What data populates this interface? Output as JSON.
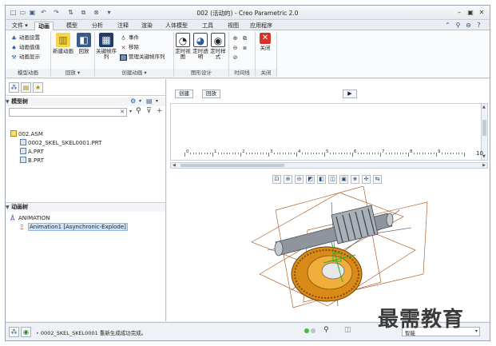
{
  "window": {
    "title": "002 (活动的) - Creo Parametric 2.0",
    "minimize_icon": "minimize-icon",
    "maximize_icon": "maximize-icon",
    "close_icon": "close-icon"
  },
  "quick_access": [
    "new-icon",
    "open-icon",
    "save-icon",
    "undo-icon",
    "redo-icon",
    "regenerate-icon",
    "windows-icon",
    "close-window-icon"
  ],
  "tabs": [
    {
      "label": "文件",
      "has_dropdown": true
    },
    {
      "label": "动画",
      "active": true
    },
    {
      "label": "模型"
    },
    {
      "label": "分析"
    },
    {
      "label": "注释"
    },
    {
      "label": "渲染"
    },
    {
      "label": "人体模型"
    },
    {
      "label": "工具"
    },
    {
      "label": "视图"
    },
    {
      "label": "应用程序"
    }
  ],
  "ribbon": {
    "groups": [
      {
        "label": "模型动画",
        "items": [
          {
            "label": "动画设置",
            "icon": "animation-settings-icon"
          },
          {
            "label": "动画值值",
            "icon": "animation-value-icon"
          },
          {
            "label": "动画显示",
            "icon": "animation-display-icon"
          }
        ]
      },
      {
        "label": "回放",
        "items": [
          {
            "label": "新建动画",
            "icon": "new-animation-icon"
          },
          {
            "label": "回放",
            "icon": "playback-icon"
          }
        ]
      },
      {
        "label": "创建动画",
        "items": [
          {
            "label": "关键帧序列",
            "icon": "keyframe-sequence-icon"
          },
          {
            "label": "事件",
            "icon": "event-icon"
          },
          {
            "label": "移除",
            "icon": "remove-icon"
          },
          {
            "label": "管理关键帧序列",
            "icon": "manage-keyframe-icon"
          }
        ]
      },
      {
        "label": "图形设计",
        "items": [
          {
            "label": "定时视图",
            "icon": "timed-view-icon"
          },
          {
            "label": "定时透明",
            "icon": "timed-transparency-icon"
          },
          {
            "label": "定时样式",
            "icon": "timed-style-icon"
          }
        ]
      },
      {
        "label": "时间线",
        "items": [
          {
            "label": "",
            "icon": "zoom-in-time-icon"
          },
          {
            "label": "",
            "icon": "zoom-out-time-icon"
          },
          {
            "label": "",
            "icon": "refit-time-icon"
          }
        ]
      },
      {
        "label": "关闭",
        "items": [
          {
            "label": "关闭",
            "icon": "close-red-icon"
          }
        ]
      }
    ],
    "right_icons": [
      "minimize-ribbon-icon",
      "search-icon",
      "help-dropdown-icon",
      "help-icon"
    ]
  },
  "left_panel": {
    "tool_buttons": [
      "model-tree-icon",
      "folder-browser-icon",
      "favorites-icon"
    ],
    "model_tree_header": "模型树",
    "search_placeholder": "",
    "model_tree_items": [
      {
        "label": "002.ASM",
        "level": 0
      },
      {
        "label": "0002_SKEL_SKEL0001.PRT",
        "level": 1
      },
      {
        "label": "A.PRT",
        "level": 1
      },
      {
        "label": "B.PRT",
        "level": 1
      }
    ],
    "animation_tree_header": "动画树",
    "animation_tree_items": [
      {
        "label": "ANIMATION",
        "level": 0
      },
      {
        "label": "Animation1 [Asynchronic-Explode]",
        "level": 1,
        "selected": true
      }
    ]
  },
  "timeline": {
    "create_label": "创建",
    "playback_label": "回放",
    "play_icon": "play-icon",
    "ruler_ticks": [
      "0",
      "1",
      "2",
      "3",
      "4",
      "5",
      "6",
      "7",
      "8",
      "9",
      "10"
    ],
    "ruler_end": "10"
  },
  "view_toolbar": [
    "refit-icon",
    "zoom-in-icon",
    "zoom-out-icon",
    "repaint-icon",
    "view-orient-icon",
    "saved-views-icon",
    "display-style-icon",
    "datum-display-icon",
    "spin-center-icon",
    "annotation-display-icon"
  ],
  "status": {
    "message": "0002_SKEL_SKEL0001 重新生成成功完成。",
    "filter_value": "智能",
    "status_light": "#3fbf3f"
  },
  "watermark": "最需教育"
}
